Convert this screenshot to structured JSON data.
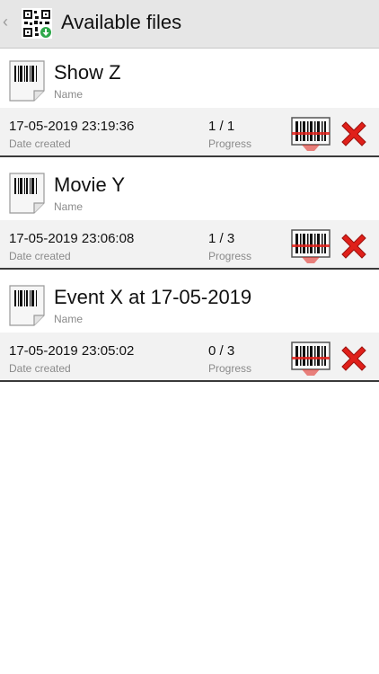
{
  "header": {
    "title": "Available files",
    "back_icon": "chevron-left-icon",
    "app_icon": "qr-code-icon"
  },
  "labels": {
    "name_caption": "Name",
    "date_caption": "Date created",
    "progress_caption": "Progress"
  },
  "files": [
    {
      "name": "Show Z",
      "date": "17-05-2019 23:19:36",
      "progress": "1 / 1"
    },
    {
      "name": "Movie Y",
      "date": "17-05-2019 23:06:08",
      "progress": "1 / 3"
    },
    {
      "name": "Event X at 17-05-2019",
      "date": "17-05-2019 23:05:02",
      "progress": "0 / 3"
    }
  ],
  "colors": {
    "header_bg": "#e6e6e6",
    "row_bg": "#f2f2f2",
    "delete_red": "#e0201a",
    "scan_red": "#e0201a"
  }
}
